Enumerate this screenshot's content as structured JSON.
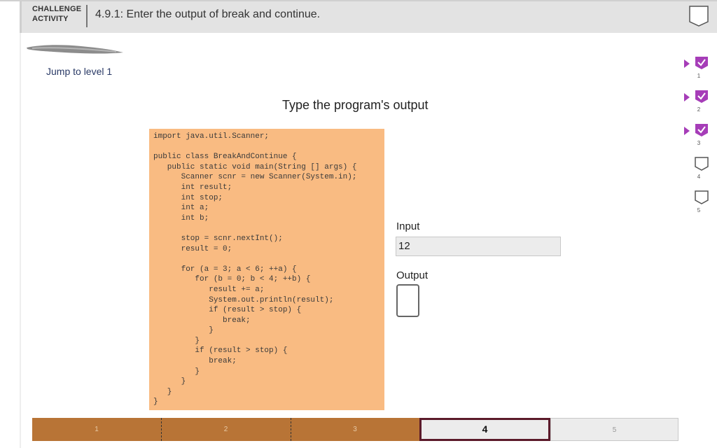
{
  "header": {
    "badge_line1": "CHALLENGE",
    "badge_line2": "ACTIVITY",
    "title": "4.9.1: Enter the output of break and continue."
  },
  "jump_link": "Jump to level 1",
  "prompt": "Type the program's output",
  "code": "import java.util.Scanner;\n\npublic class BreakAndContinue {\n   public static void main(String [] args) {\n      Scanner scnr = new Scanner(System.in);\n      int result;\n      int stop;\n      int a;\n      int b;\n\n      stop = scnr.nextInt();\n      result = 0;\n\n      for (a = 3; a < 6; ++a) {\n         for (b = 0; b < 4; ++b) {\n            result += a;\n            System.out.println(result);\n            if (result > stop) {\n               break;\n            }\n         }\n         if (result > stop) {\n            break;\n         }\n      }\n   }\n}",
  "input": {
    "label": "Input",
    "value": "12"
  },
  "output": {
    "label": "Output",
    "value": ""
  },
  "levels": [
    {
      "number": "1",
      "completed": true
    },
    {
      "number": "2",
      "completed": true
    },
    {
      "number": "3",
      "completed": true
    },
    {
      "number": "4",
      "completed": false
    },
    {
      "number": "5",
      "completed": false
    }
  ],
  "progress": [
    {
      "label": "1",
      "state": "done"
    },
    {
      "label": "2",
      "state": "done"
    },
    {
      "label": "3",
      "state": "done"
    },
    {
      "label": "4",
      "state": "current"
    },
    {
      "label": "5",
      "state": "future"
    }
  ],
  "colors": {
    "code_bg": "#f9bb82",
    "check": "#a63db8",
    "progress_done": "#b87436",
    "progress_current_border": "#5b1a2a"
  },
  "icons": {
    "level_done": "checkbox-checked-icon",
    "level_todo": "checkbox-empty-icon",
    "activity_status": "badge-empty-icon"
  }
}
